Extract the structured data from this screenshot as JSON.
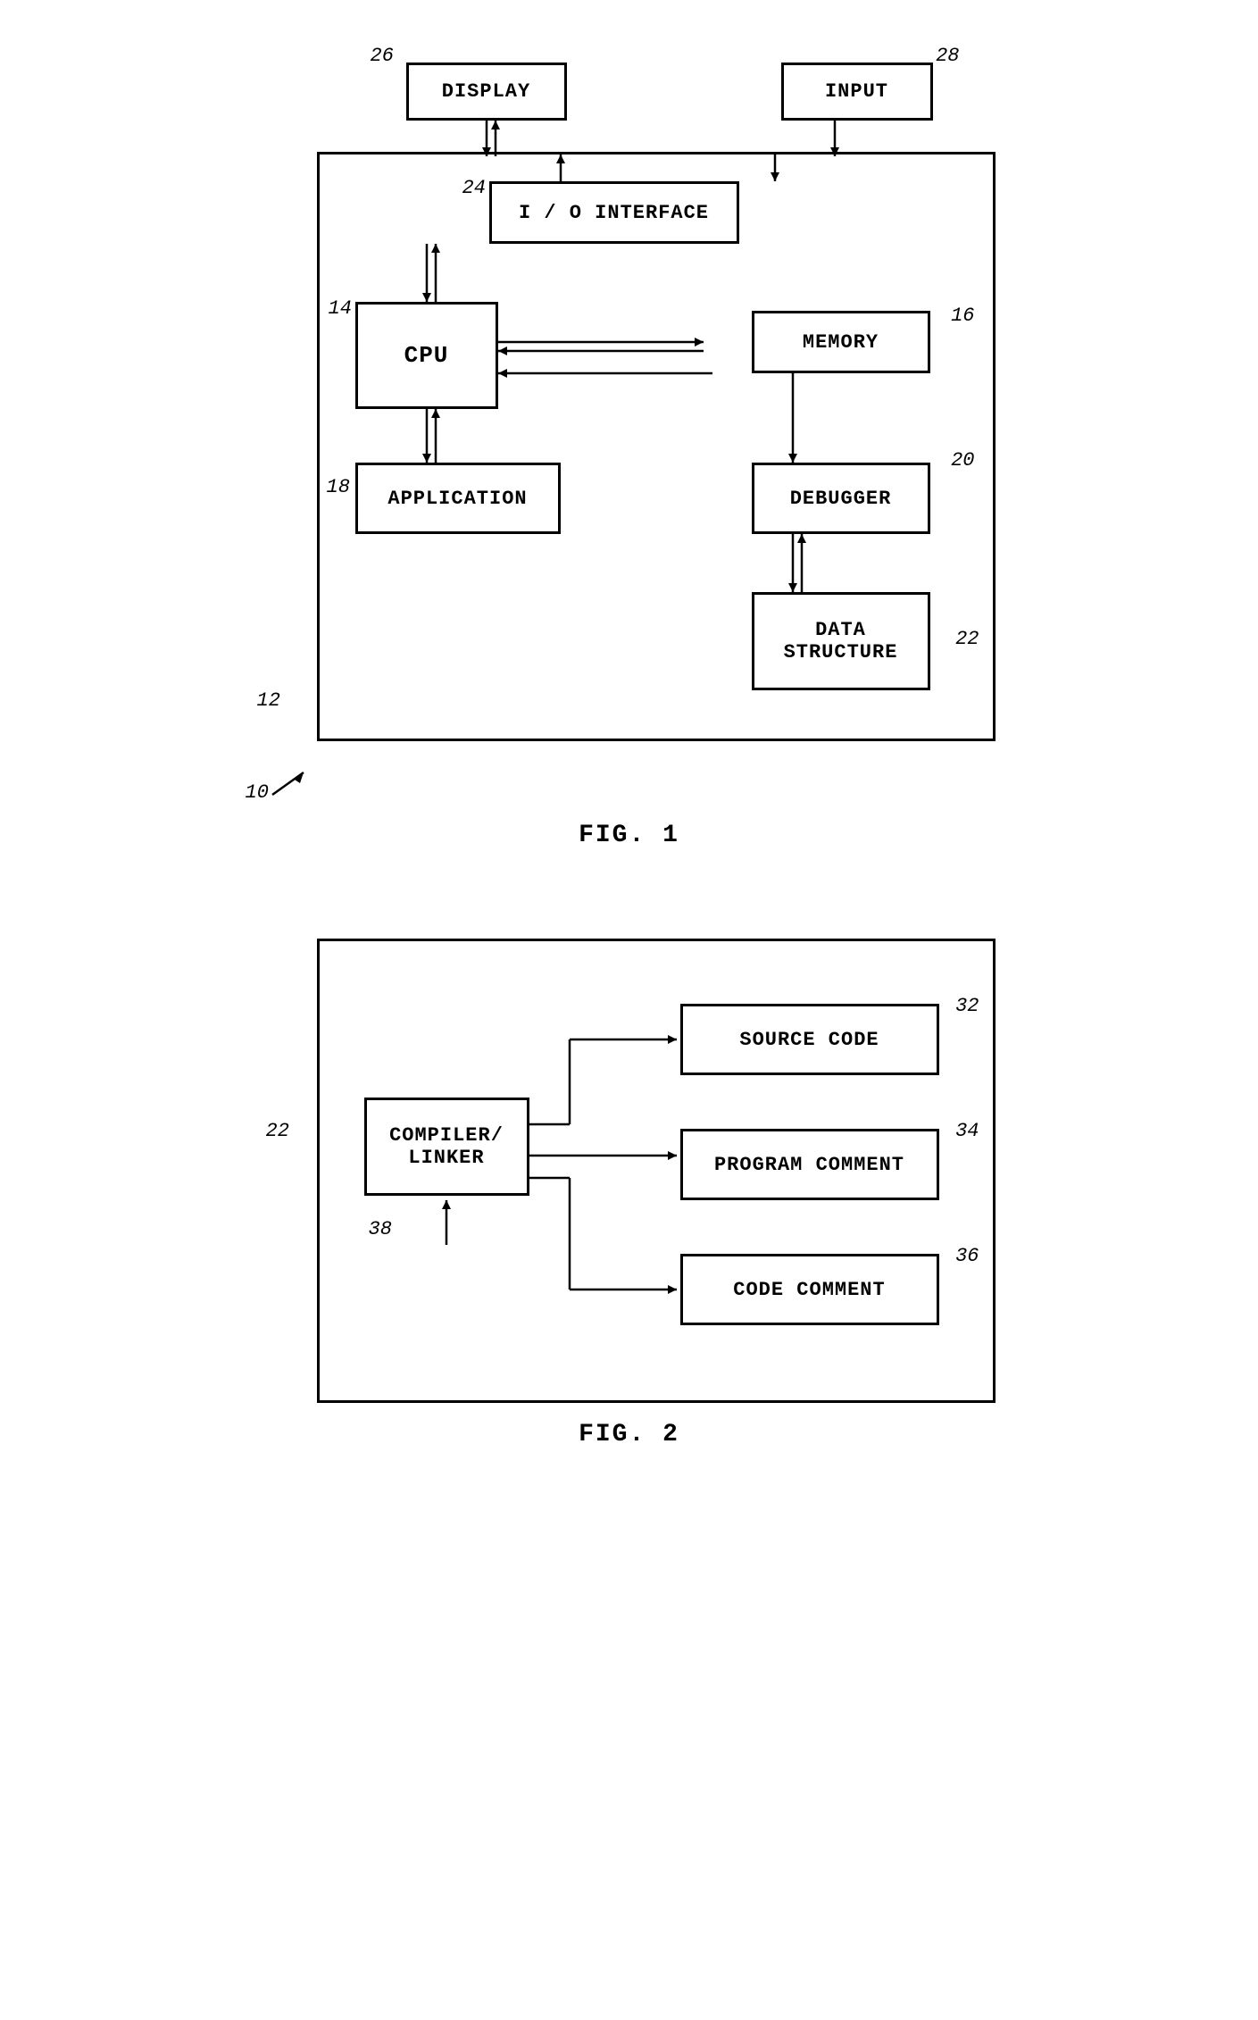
{
  "fig1": {
    "title": "FIG. 1",
    "outer_label": "12",
    "blocks": {
      "display": {
        "label": "DISPLAY",
        "ref": "26"
      },
      "input": {
        "label": "INPUT",
        "ref": "28"
      },
      "io": {
        "label": "I / O  INTERFACE",
        "ref": "24"
      },
      "cpu": {
        "label": "CPU",
        "ref": "14"
      },
      "memory": {
        "label": "MEMORY",
        "ref": "16"
      },
      "application": {
        "label": "APPLICATION",
        "ref": "18"
      },
      "debugger": {
        "label": "DEBUGGER",
        "ref": "20"
      },
      "datastructure": {
        "label1": "DATA",
        "label2": "STRUCTURE",
        "ref": "22"
      }
    },
    "system_label": "10"
  },
  "fig2": {
    "title": "FIG. 2",
    "outer_label": "22",
    "blocks": {
      "compiler": {
        "label1": "COMPILER/",
        "label2": "LINKER",
        "ref": "38"
      },
      "sourcecode": {
        "label": "SOURCE CODE",
        "ref": "32"
      },
      "programcomment": {
        "label": "PROGRAM COMMENT",
        "ref": "34"
      },
      "codecomment": {
        "label": "CODE COMMENT",
        "ref": "36"
      }
    }
  }
}
